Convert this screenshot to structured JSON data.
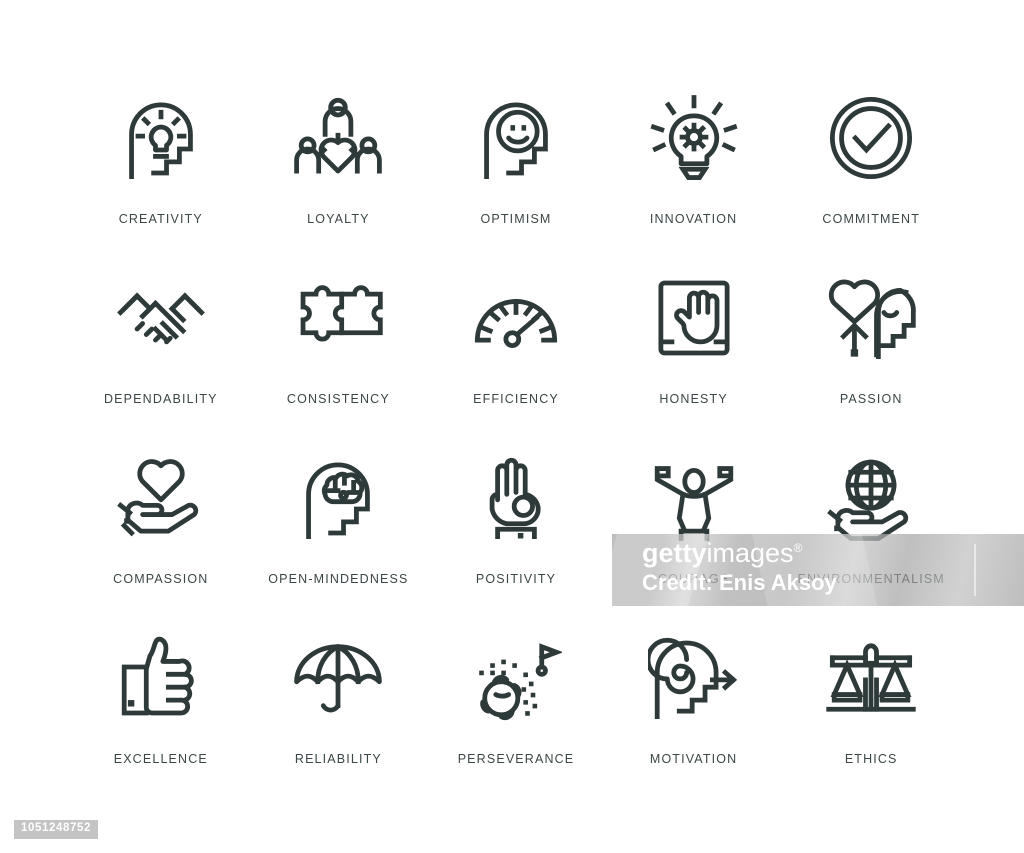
{
  "page": {
    "background_color": "#ffffff",
    "icon_stroke_color": "#2e3a3a",
    "caption_color": "#3b4646",
    "grid_columns": 5,
    "grid_rows": 4
  },
  "icons": [
    {
      "id": "creativity",
      "label": "CREATIVITY",
      "icon": "head-lightbulb-icon"
    },
    {
      "id": "loyalty",
      "label": "LOYALTY",
      "icon": "people-heart-icon"
    },
    {
      "id": "optimism",
      "label": "OPTIMISM",
      "icon": "head-smiley-icon"
    },
    {
      "id": "innovation",
      "label": "INNOVATION",
      "icon": "lightbulb-gear-icon"
    },
    {
      "id": "commitment",
      "label": "COMMITMENT",
      "icon": "check-circle-icon"
    },
    {
      "id": "dependability",
      "label": "DEPENDABILITY",
      "icon": "handshake-icon"
    },
    {
      "id": "consistency",
      "label": "CONSISTENCY",
      "icon": "puzzle-pieces-icon"
    },
    {
      "id": "efficiency",
      "label": "EFFICIENCY",
      "icon": "speedometer-icon"
    },
    {
      "id": "honesty",
      "label": "HONESTY",
      "icon": "hand-oath-icon"
    },
    {
      "id": "passion",
      "label": "PASSION",
      "icon": "head-heart-arrow-icon"
    },
    {
      "id": "compassion",
      "label": "COMPASSION",
      "icon": "hand-heart-icon"
    },
    {
      "id": "open-mindedness",
      "label": "OPEN-MINDEDNESS",
      "icon": "head-brain-icon"
    },
    {
      "id": "positivity",
      "label": "POSITIVITY",
      "icon": "hand-ok-icon"
    },
    {
      "id": "courage",
      "label": "COURAGE",
      "icon": "person-arms-raised-icon"
    },
    {
      "id": "environmentalism",
      "label": "ENVIRONMENTALISM",
      "icon": "hand-globe-icon"
    },
    {
      "id": "excellence",
      "label": "EXCELLENCE",
      "icon": "thumbs-up-icon"
    },
    {
      "id": "reliability",
      "label": "RELIABILITY",
      "icon": "umbrella-icon"
    },
    {
      "id": "perseverance",
      "label": "PERSEVERANCE",
      "icon": "rolling-boulder-flag-icon"
    },
    {
      "id": "motivation",
      "label": "MOTIVATION",
      "icon": "head-spiral-arrow-icon"
    },
    {
      "id": "ethics",
      "label": "ETHICS",
      "icon": "scales-balance-icon"
    }
  ],
  "watermark": {
    "logo_bold": "getty",
    "logo_light": "images",
    "registered_mark": "®",
    "credit": "Credit: Enis Aksoy"
  },
  "id_badge": {
    "value": "1051248752"
  }
}
